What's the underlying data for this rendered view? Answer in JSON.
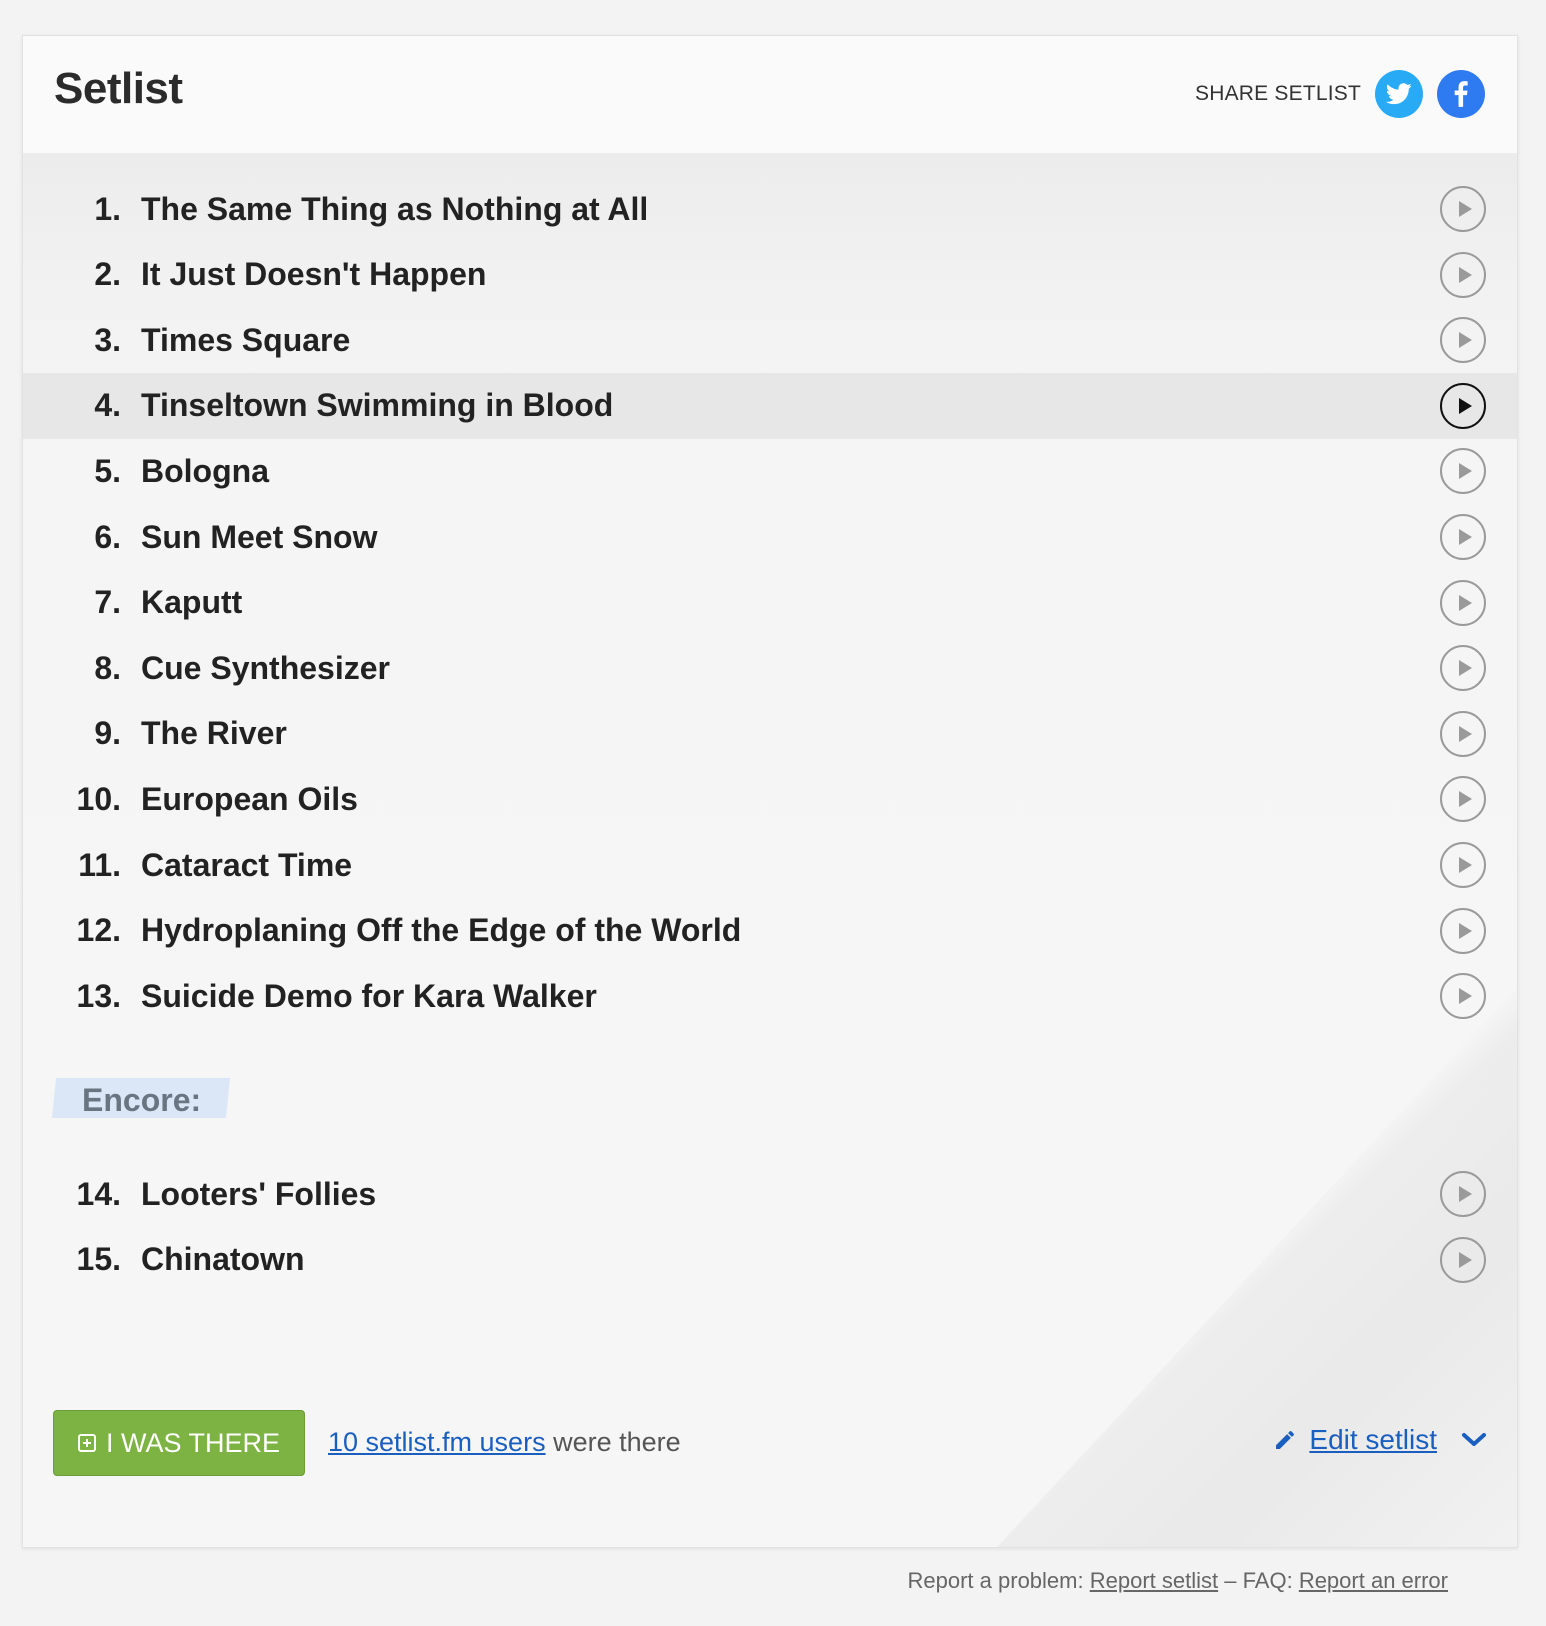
{
  "header": {
    "title": "Setlist",
    "share_label": "SHARE SETLIST",
    "twitter_icon": "twitter-icon",
    "facebook_icon": "facebook-icon",
    "twitter_color": "#29aaf4",
    "facebook_color": "#2e7af0"
  },
  "songs": [
    {
      "num": "1.",
      "name": "The Same Thing as Nothing at All"
    },
    {
      "num": "2.",
      "name": "It Just Doesn't Happen"
    },
    {
      "num": "3.",
      "name": "Times Square"
    },
    {
      "num": "4.",
      "name": "Tinseltown Swimming in Blood",
      "active": true
    },
    {
      "num": "5.",
      "name": "Bologna"
    },
    {
      "num": "6.",
      "name": "Sun Meet Snow"
    },
    {
      "num": "7.",
      "name": "Kaputt"
    },
    {
      "num": "8.",
      "name": "Cue Synthesizer"
    },
    {
      "num": "9.",
      "name": "The River"
    },
    {
      "num": "10.",
      "name": "European Oils"
    },
    {
      "num": "11.",
      "name": "Cataract Time"
    },
    {
      "num": "12.",
      "name": "Hydroplaning Off the Edge of the World"
    },
    {
      "num": "13.",
      "name": "Suicide Demo for Kara Walker"
    }
  ],
  "encore": {
    "label": "Encore:",
    "songs": [
      {
        "num": "14.",
        "name": "Looters' Follies"
      },
      {
        "num": "15.",
        "name": "Chinatown"
      }
    ]
  },
  "actions": {
    "was_there_label": "I WAS THERE",
    "users_link": "10 setlist.fm users",
    "users_suffix": " were there",
    "edit_label": "Edit setlist",
    "accent_color": "#7cb342",
    "link_color": "#1a5fc0"
  },
  "footer": {
    "prefix": "Report a problem: ",
    "report_setlist": "Report setlist",
    "separator": " – FAQ: ",
    "report_error": "Report an error"
  }
}
